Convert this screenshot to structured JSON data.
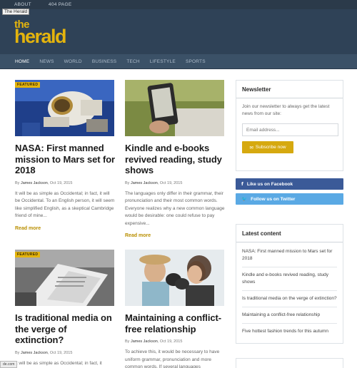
{
  "topbar": {
    "links": [
      "ABOUT",
      "404 PAGE"
    ],
    "tooltip": "The Herald"
  },
  "logo": {
    "line1": "the",
    "line2": "herald"
  },
  "nav": {
    "items": [
      "HOME",
      "NEWS",
      "WORLD",
      "BUSINESS",
      "TECH",
      "LIFESTYLE",
      "SPORTS"
    ]
  },
  "articles": [
    {
      "badge": "FEATURED",
      "title": "NASA: First manned mission to Mars set for 2018",
      "by": "By",
      "author": "James Jackson",
      "date": "Oct 19, 2015",
      "excerpt": "It will be as simple as Occidental; in fact, it will be Occidental. To an English person, it will seem like simplified English, as a skeptical Cambridge friend of mine...",
      "read_more": "Read more"
    },
    {
      "badge": "",
      "title": "Kindle and e-books revived reading, study shows",
      "by": "By",
      "author": "James Jackson",
      "date": "Oct 19, 2015",
      "excerpt": "The languages only differ in their grammar, their pronunciation and their most common words. Everyone realizes why a new common language would be desirable: one could refuse to pay expensive...",
      "read_more": "Read more"
    },
    {
      "badge": "FEATURED",
      "title": "Is traditional media on the verge of extinction?",
      "by": "By",
      "author": "James Jackson",
      "date": "Oct 19, 2015",
      "excerpt": "It will be as simple as Occidental; in fact, it",
      "read_more": ""
    },
    {
      "badge": "",
      "title": "Maintaining a conflict-free relationship",
      "by": "By",
      "author": "James Jackson",
      "date": "Oct 19, 2015",
      "excerpt": "To achieve this, it would be necessary to have uniform grammar, pronunciation and more common words. If several languages",
      "read_more": ""
    }
  ],
  "newsletter": {
    "title": "Newsletter",
    "text": "Join our newsletter to always get the latest news from our site:",
    "placeholder": "Email address...",
    "button": "Subscribe now"
  },
  "social": {
    "facebook": "Like us on Facebook",
    "twitter": "Follow us on Twitter"
  },
  "latest": {
    "title": "Latest content",
    "items": [
      "NASA: First manned mission to Mars set for 2018",
      "Kindle and e-books revived reading, study shows",
      "Is traditional media on the verge of extinction?",
      "Maintaining a conflict-free relationship",
      "Five hottest fashion trends for this autumn"
    ]
  },
  "status": {
    "text": "de.com"
  },
  "colors": {
    "accent": "#e4b40d",
    "header": "#2f4257",
    "nav": "#3b5167",
    "facebook": "#3b5a98",
    "twitter": "#5aa9e4"
  }
}
